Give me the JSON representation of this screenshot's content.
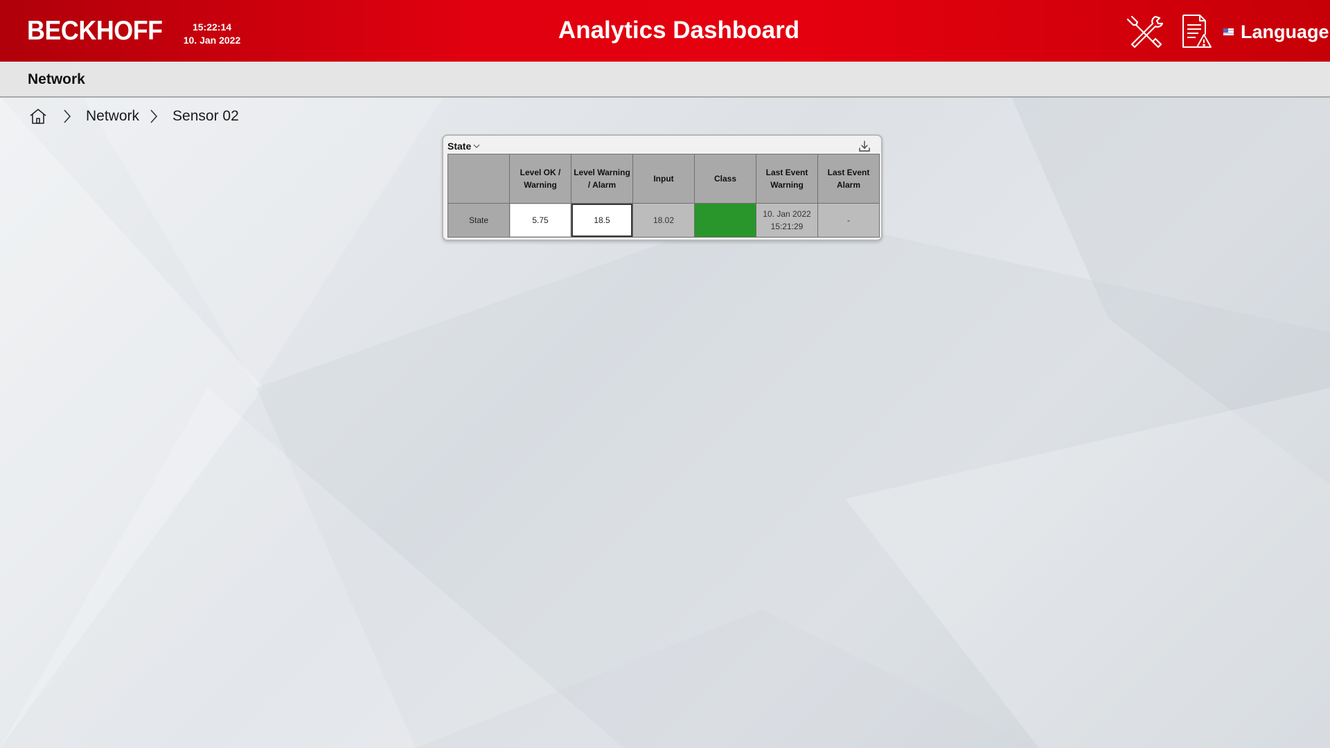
{
  "header": {
    "brand": "BECKHOFF",
    "time": "15:22:14",
    "date": "10. Jan 2022",
    "title": "Analytics Dashboard",
    "language_label": "Language"
  },
  "subheader": {
    "section_title": "Network"
  },
  "breadcrumb": {
    "items": [
      "Network",
      "Sensor 02"
    ]
  },
  "panel": {
    "title": "State",
    "columns": [
      "",
      "Level OK / Warning",
      "Level Warning / Alarm",
      "Input",
      "Class",
      "Last Event Warning",
      "Last Event Alarm"
    ],
    "row": {
      "label": "State",
      "level_ok_warning": "5.75",
      "level_warning_alarm": "18.5",
      "input": "18.02",
      "class_color": "#28962a",
      "last_event_warning_date": "10. Jan 2022",
      "last_event_warning_time": "15:21:29",
      "last_event_alarm": "-"
    }
  },
  "colors": {
    "header_red": "#e5000f",
    "subheader_bg": "#e5e5e5",
    "class_ok_green": "#28962a"
  },
  "icons": {
    "tools": "tools-icon",
    "report": "report-warning-icon",
    "flag": "flag-icon",
    "home": "home-icon",
    "separator": "chevron-right-icon",
    "dropdown": "chevron-down-icon",
    "download": "download-icon"
  }
}
